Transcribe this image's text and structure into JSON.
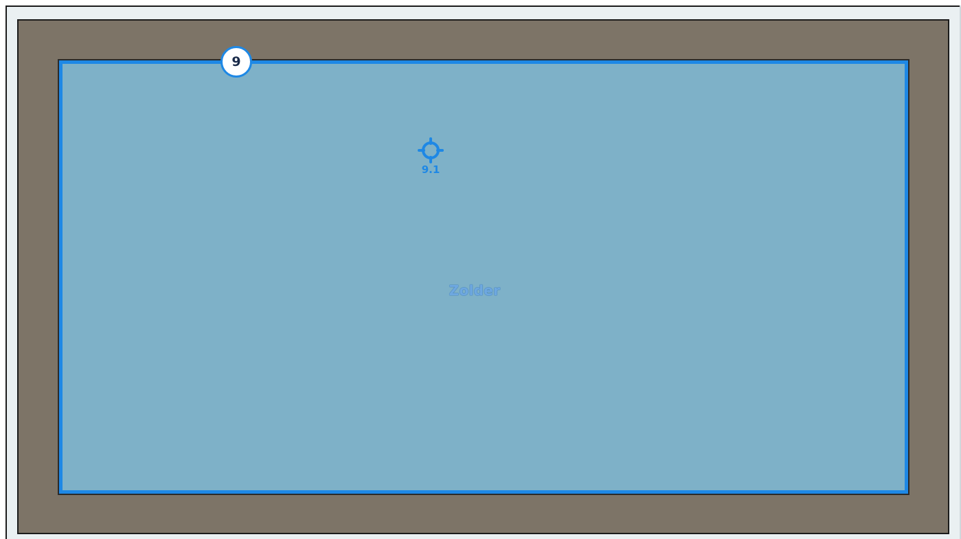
{
  "floorplan": {
    "room": {
      "name": "Zolder",
      "number": "9",
      "fill_color": "#7eb1c8",
      "border_color": "#1e88e5"
    },
    "sensor": {
      "label": "9.1",
      "icon": "crosshair-icon",
      "color": "#1e88e5"
    },
    "wall_color": "#7d7467",
    "background_color": "#eaf0f2"
  }
}
